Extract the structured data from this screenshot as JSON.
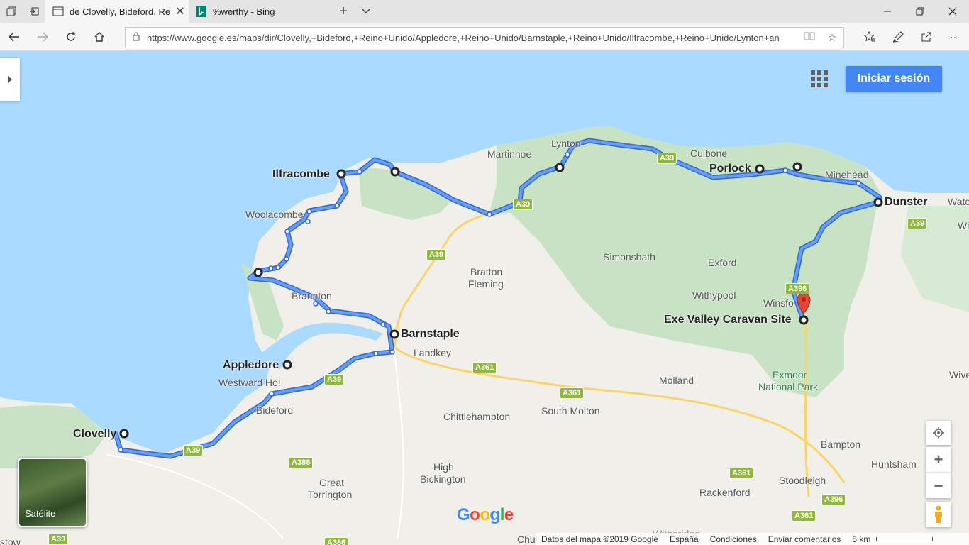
{
  "browser": {
    "tabs": [
      {
        "title": "de Clovelly, Bideford, Re",
        "active": true
      },
      {
        "title": "%werthy - Bing",
        "active": false
      }
    ],
    "url": "https://www.google.es/maps/dir/Clovelly,+Bideford,+Reino+Unido/Appledore,+Reino+Unido/Barnstaple,+Reino+Unido/Ilfracombe,+Reino+Unido/Lynton+an"
  },
  "map": {
    "signin_label": "Iniciar sesión",
    "satellite_label": "Satélite",
    "logo": "Google",
    "footer": {
      "data": "Datos del mapa ©2019 Google",
      "country": "España",
      "terms": "Condiciones",
      "feedback": "Enviar comentarios",
      "scale": "5 km"
    },
    "places": {
      "clovelly": "Clovelly",
      "appledore": "Appledore",
      "barnstaple": "Barnstaple",
      "ilfracombe": "Ilfracombe",
      "porlock": "Porlock",
      "dunster": "Dunster",
      "exe_valley": "Exe Valley Caravan Site",
      "martinhoe": "Martinhoe",
      "lynton": "Lynton",
      "culbone": "Culbone",
      "minehead": "Minehead",
      "watchet": "Watc",
      "wi": "Wi",
      "woolacombe": "Woolacombe",
      "braunton": "Braunton",
      "bratton": "Bratton",
      "fleming": "Fleming",
      "simonsbath": "Simonsbath",
      "exford": "Exford",
      "withypool": "Withypool",
      "winsford": "Winsfo",
      "landkey": "Landkey",
      "westward_ho": "Westward Ho!",
      "bideford": "Bideford",
      "molland": "Molland",
      "exmoor1": "Exmoor",
      "exmoor2": "National Park",
      "wive": "Wive",
      "chittlehampton": "Chittlehampton",
      "south_molton": "South Molton",
      "high": "High",
      "bickington": "Bickington",
      "great": "Great",
      "torrington": "Torrington",
      "bampton": "Bampton",
      "huntsham": "Huntsham",
      "stoodleigh": "Stoodleigh",
      "rackenford": "Rackenford",
      "chul": "Chul",
      "witheridge": "Witheridge",
      "stow": "stow"
    },
    "roads": {
      "a39": "A39",
      "a361": "A361",
      "a386": "A386",
      "a396": "A396"
    },
    "colors": {
      "sea": "#aadaff",
      "land": "#f0efe9",
      "park": "#c8e3c4",
      "route": "#5b8ff0",
      "route_outline": "#3367d6",
      "pin": "#ea4335"
    }
  }
}
